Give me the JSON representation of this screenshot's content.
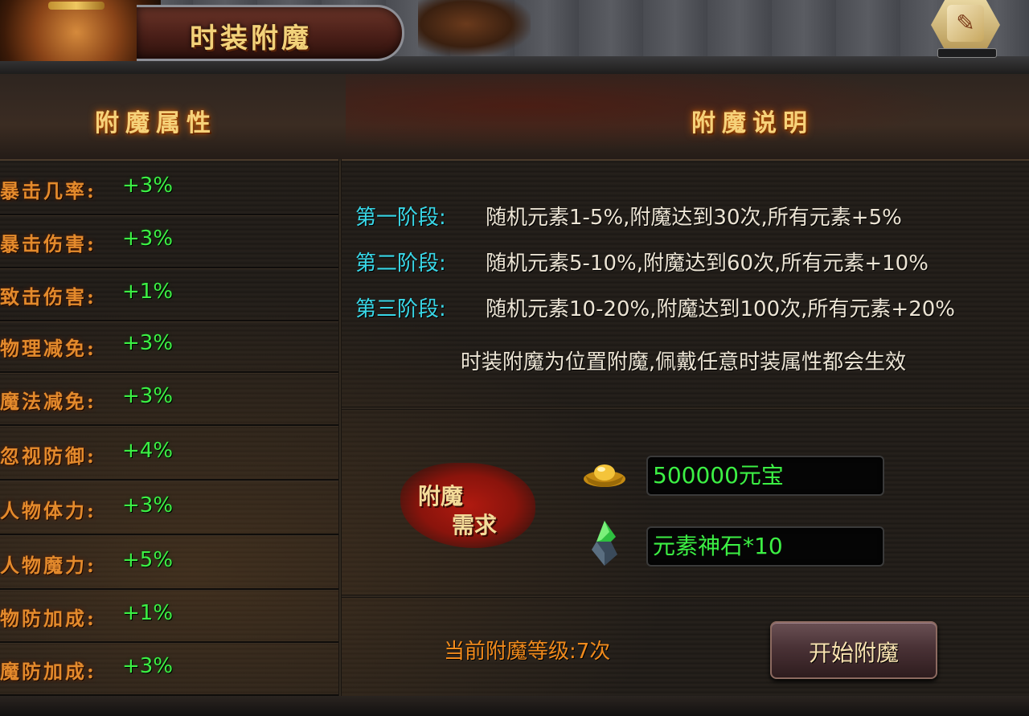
{
  "window": {
    "title": "时装附魔"
  },
  "attributes": {
    "heading": "附魔属性",
    "items": [
      {
        "label": "暴击几率:",
        "value": "+3%"
      },
      {
        "label": "暴击伤害:",
        "value": "+3%"
      },
      {
        "label": "致击伤害:",
        "value": "+1%"
      },
      {
        "label": "物理减免:",
        "value": "+3%"
      },
      {
        "label": "魔法减免:",
        "value": "+3%"
      },
      {
        "label": "忽视防御:",
        "value": "+4%"
      },
      {
        "label": "人物体力:",
        "value": "+3%"
      },
      {
        "label": "人物魔力:",
        "value": "+5%"
      },
      {
        "label": "物防加成:",
        "value": "+1%"
      },
      {
        "label": "魔防加成:",
        "value": "+3%"
      }
    ]
  },
  "description": {
    "heading": "附魔说明",
    "stages": [
      {
        "label": "第一阶段:",
        "text": "随机元素1-5%,附魔达到30次,所有元素+5%"
      },
      {
        "label": "第二阶段:",
        "text": "随机元素5-10%,附魔达到60次,所有元素+10%"
      },
      {
        "label": "第三阶段:",
        "text": "随机元素10-20%,附魔达到100次,所有元素+20%"
      }
    ],
    "note": "时装附魔为位置附魔,佩戴任意时装属性都会生效"
  },
  "requirement": {
    "label_line1": "附魔",
    "label_line2": "需求",
    "items": [
      {
        "icon": "gold-ingot-icon",
        "value": "500000元宝"
      },
      {
        "icon": "element-stone-icon",
        "value": "元素神石*10"
      }
    ]
  },
  "footer": {
    "level_text": "当前附魔等级:7次",
    "start_button": "开始附魔"
  },
  "colors": {
    "attr_label": "#e38a2c",
    "attr_value": "#3cf044",
    "stage_label": "#39d8e8",
    "body_text": "#ece4d4",
    "heading": "#f6d27a",
    "level_text": "#f08a1c"
  }
}
